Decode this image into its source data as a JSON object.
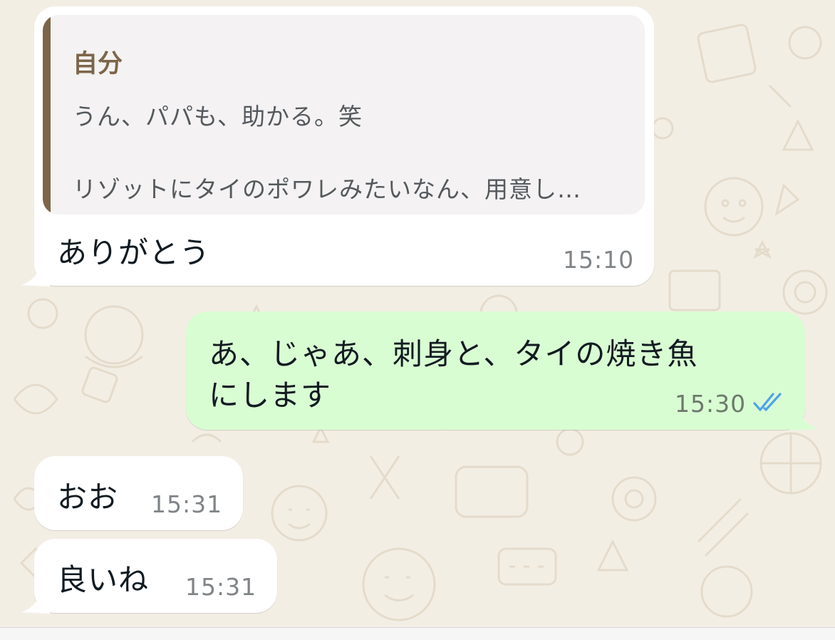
{
  "colors": {
    "chat_background": "#f3eee4",
    "incoming_bubble": "#ffffff",
    "outgoing_bubble": "#d9fdd3",
    "quote_bar": "#7c6549",
    "read_ticks": "#4fa3e8"
  },
  "messages": [
    {
      "direction": "incoming",
      "quoted": {
        "author": "自分",
        "line1": "うん、パパも、助かる。笑",
        "line2": "リゾットにタイのポワレみたいなん、用意し…"
      },
      "text": "ありがとう",
      "time": "15:10"
    },
    {
      "direction": "outgoing",
      "text_line1": "あ、じゃあ、刺身と、タイの焼き魚",
      "text_line2": "にします",
      "time": "15:30",
      "status_icon": "double-check-read-icon"
    },
    {
      "direction": "incoming",
      "text": "おお",
      "time": "15:31"
    },
    {
      "direction": "incoming",
      "text": "良いね",
      "time": "15:31"
    }
  ]
}
